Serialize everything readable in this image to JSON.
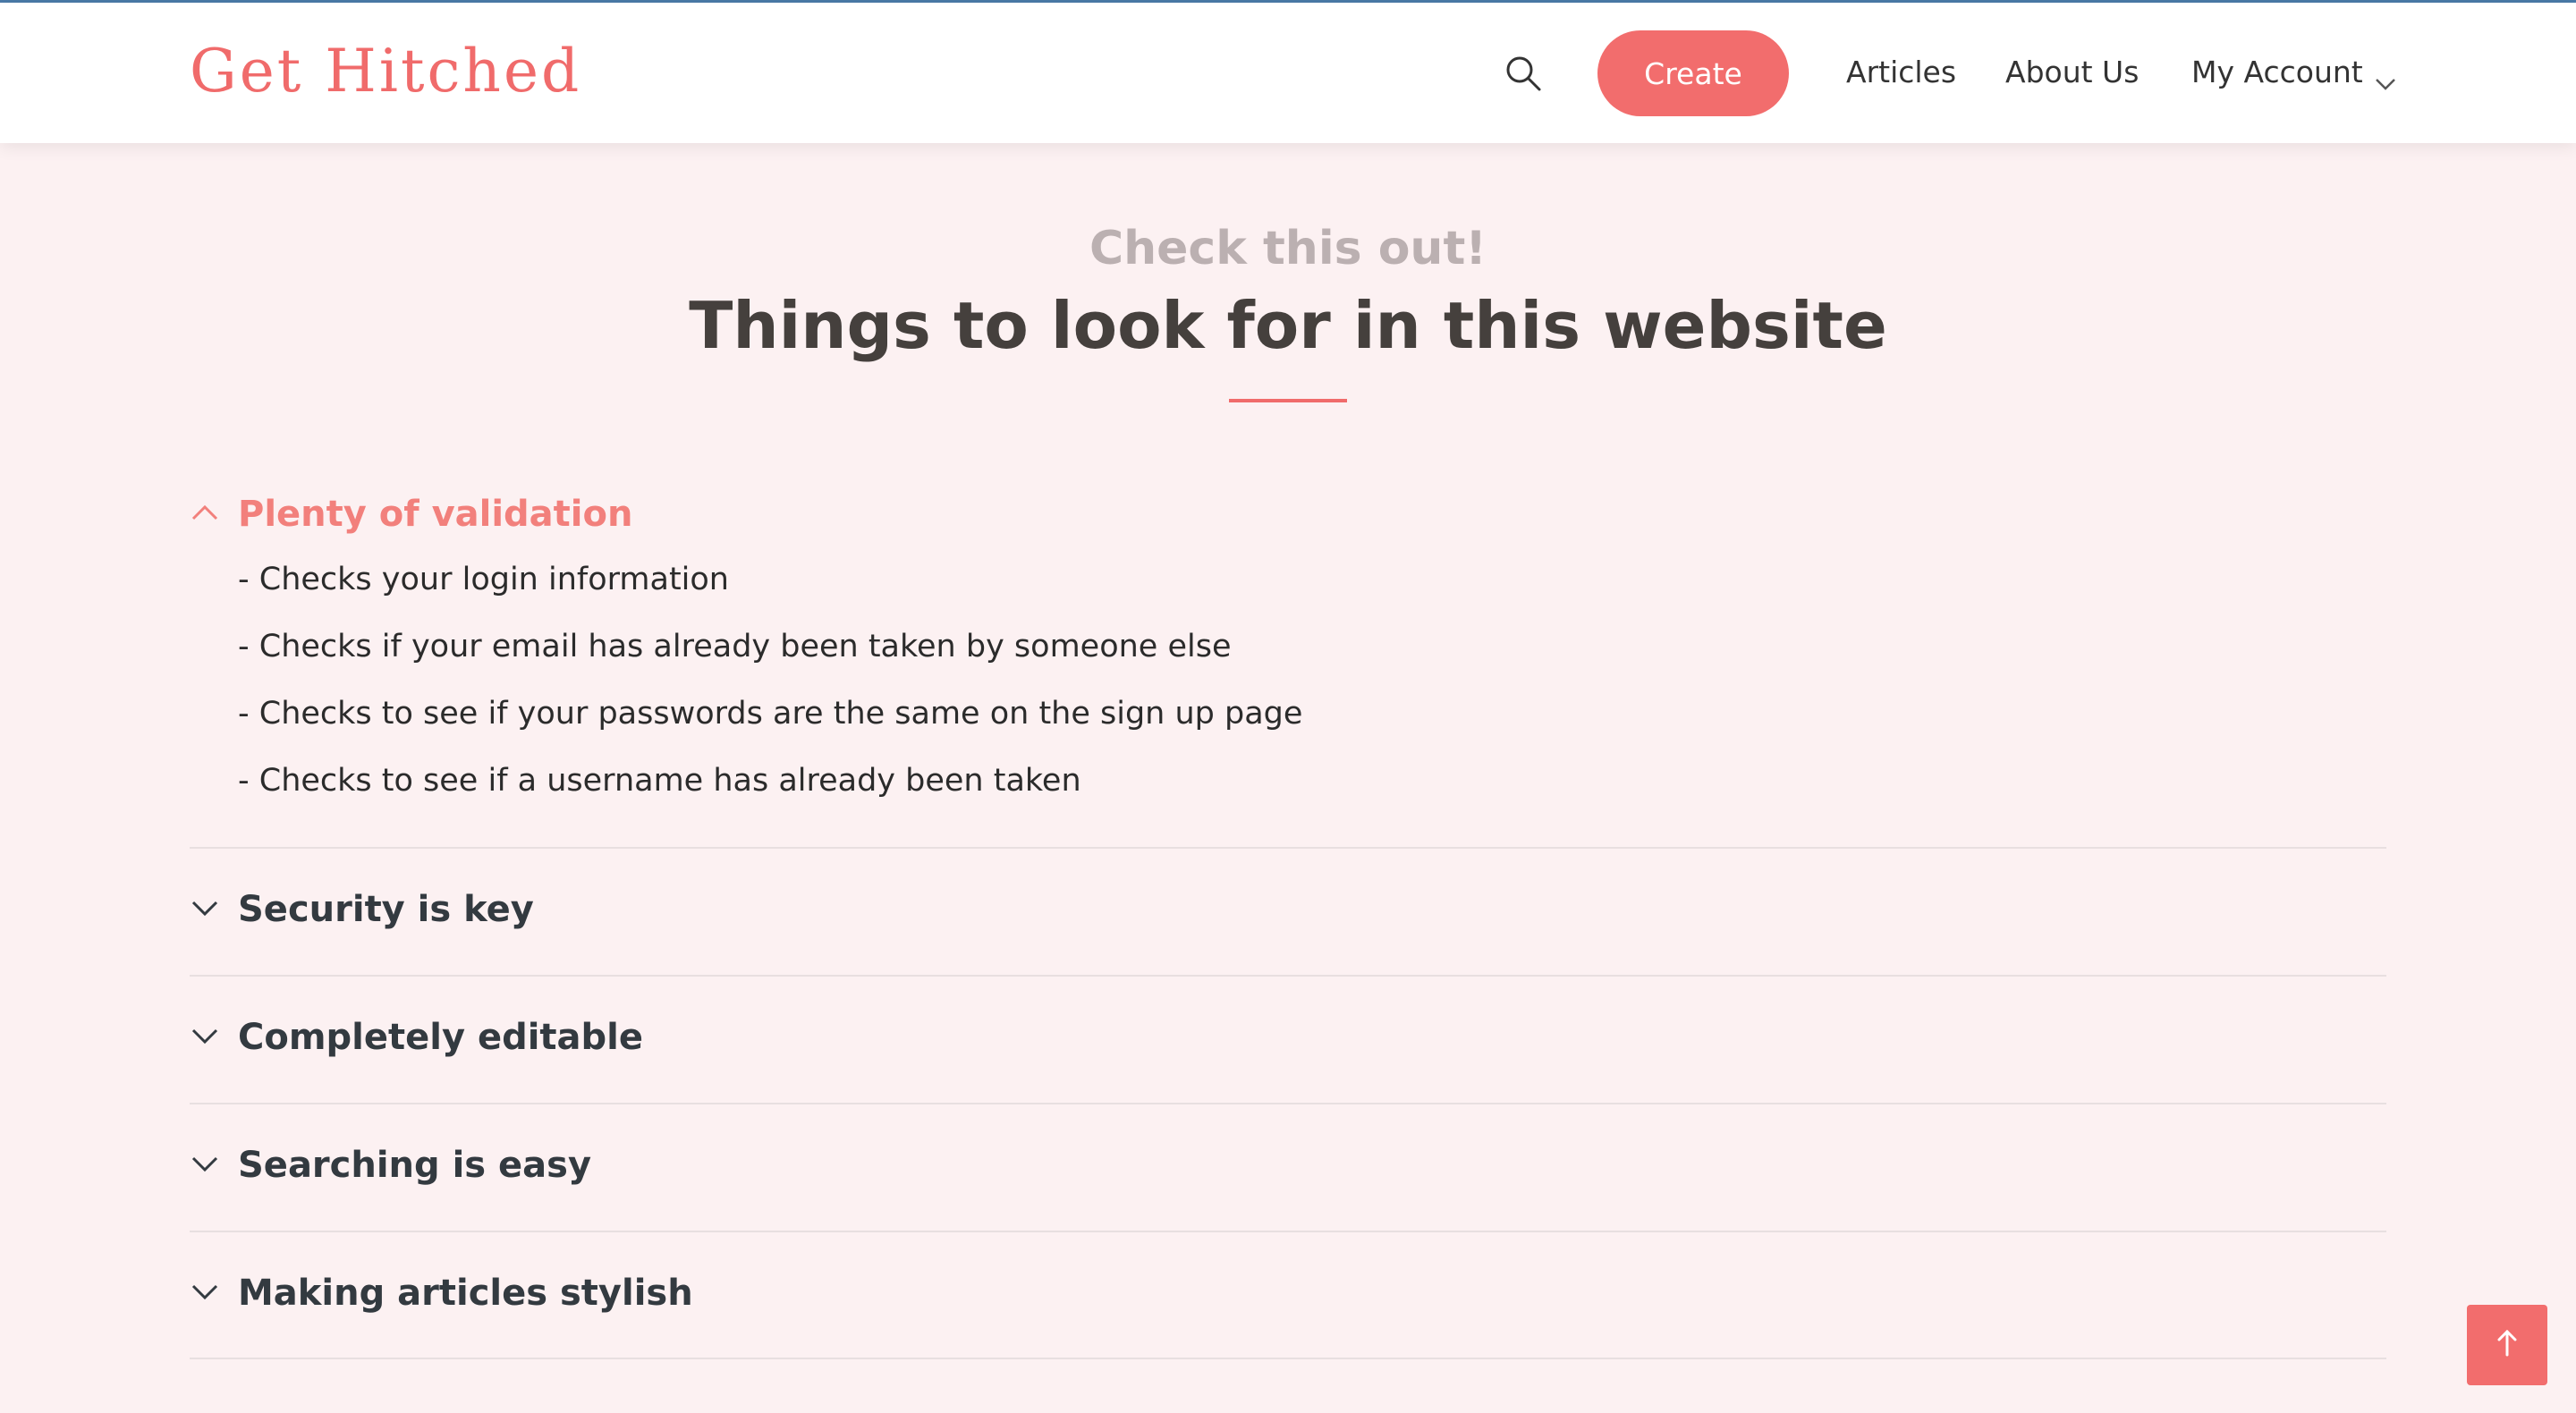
{
  "header": {
    "logo_text": "Get Hitched",
    "search_icon": "search-icon",
    "create_label": "Create",
    "nav": {
      "articles": "Articles",
      "about": "About Us",
      "account": "My Account"
    }
  },
  "section": {
    "eyebrow": "Check this out!",
    "title": "Things to look for in this website"
  },
  "accordion": {
    "items": [
      {
        "title": "Plenty of validation",
        "expanded": true,
        "lines": [
          "- Checks your login information",
          "- Checks if your email has already been taken by someone else",
          "- Checks to see if your passwords are the same on the sign up page",
          "- Checks to see if a username has already been taken"
        ]
      },
      {
        "title": "Security is key",
        "expanded": false
      },
      {
        "title": "Completely editable",
        "expanded": false
      },
      {
        "title": "Searching is easy",
        "expanded": false
      },
      {
        "title": "Making articles stylish",
        "expanded": false
      }
    ]
  },
  "colors": {
    "accent": "#f26d6d",
    "background": "#fcf1f2",
    "heading": "#45403d",
    "eyebrow": "#bbb0b1"
  }
}
